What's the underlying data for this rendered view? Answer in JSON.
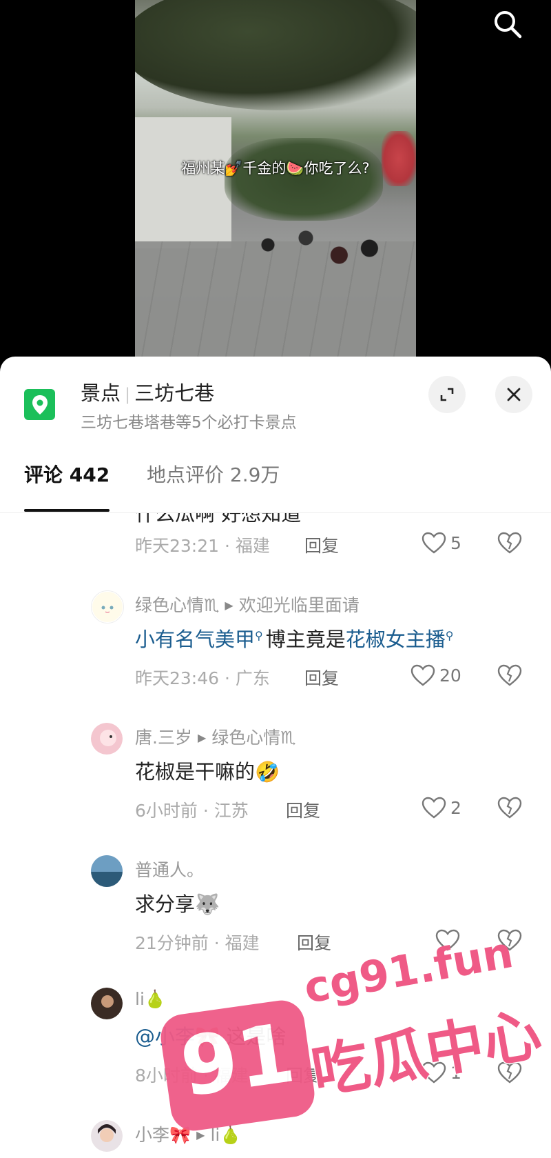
{
  "video": {
    "caption": "福州某💅千金的🍉你吃了么?"
  },
  "location": {
    "category": "景点",
    "name": "三坊七巷",
    "subtitle": "三坊七巷塔巷等5个必打卡景点"
  },
  "tabs": [
    {
      "label": "评论 442"
    },
    {
      "label": "地点评价 2.9万"
    }
  ],
  "comments": [
    {
      "text_partial": "什么瓜啊 好想知道",
      "meta": "昨天23:21 · 福建",
      "reply": "回复",
      "likes": "5"
    },
    {
      "user": "绿色心情♏",
      "reply_to": "欢迎光临里面请",
      "text_link1": "小有名气美甲",
      "text_mid": "博主竟是",
      "text_link2": "花椒女主播",
      "meta": "昨天23:46 · 广东",
      "reply": "回复",
      "likes": "20"
    },
    {
      "user": "唐.三岁",
      "reply_to": "绿色心情♏",
      "text": "花椒是干嘛的🤣",
      "meta": "6小时前 · 江苏",
      "reply": "回复",
      "likes": "2"
    },
    {
      "user": "普通人。",
      "text": "求分享🐺",
      "meta": "21分钟前 · 福建",
      "reply": "回复",
      "likes": ""
    },
    {
      "user": "li🍐",
      "text_mention": "@小李🎀",
      "text": " 这是啥",
      "meta": "8小时前 · 福建",
      "reply": "回复",
      "likes": "1"
    },
    {
      "user": "小李🎀",
      "reply_to": "li🍐"
    }
  ],
  "watermark": {
    "badge": "91",
    "url": "cg91.fun",
    "title": "吃瓜中心"
  },
  "colors": {
    "location_icon": "#1bbf5a",
    "link": "#1b5d8f",
    "watermark": "#ef5a86"
  }
}
